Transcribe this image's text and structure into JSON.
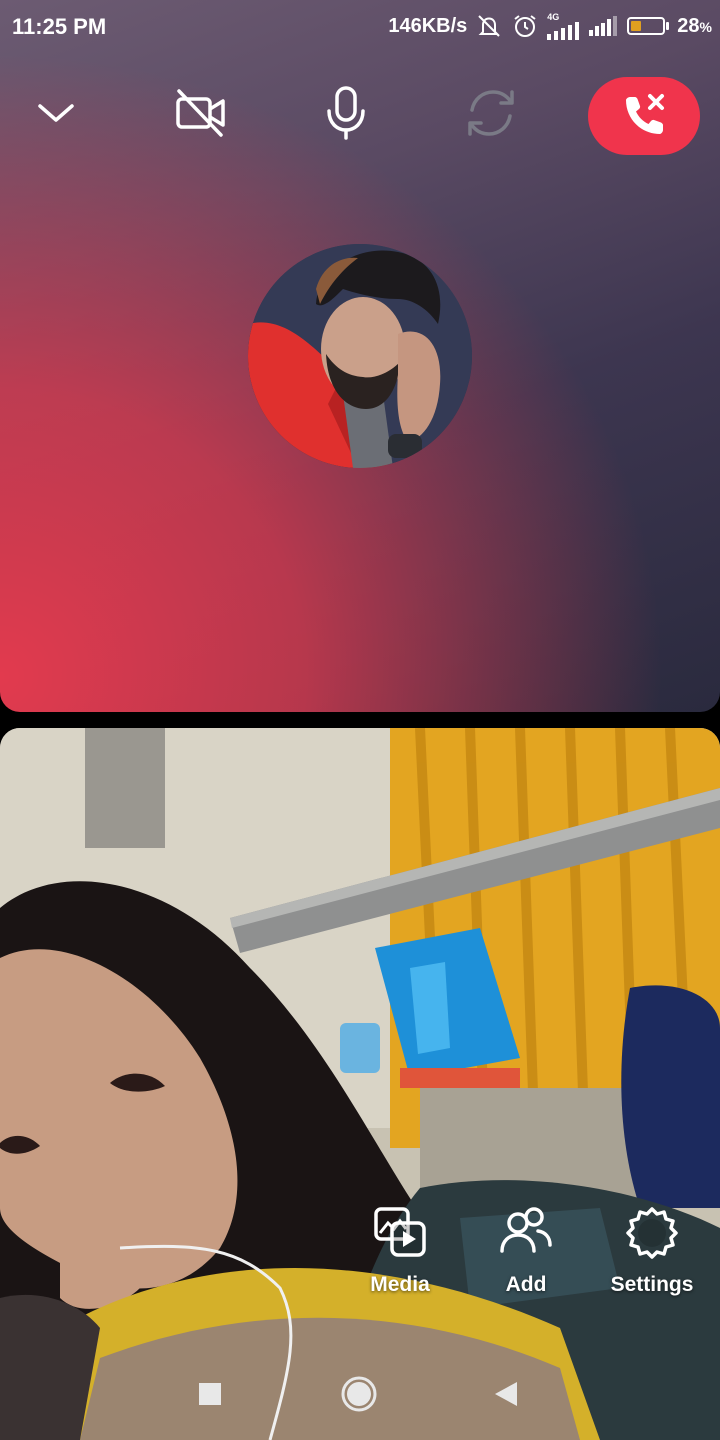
{
  "status_bar": {
    "time": "11:25 PM",
    "network_speed": "146KB/s",
    "network_type": "4G",
    "battery_percent": "28",
    "battery_symbol": "%",
    "icons": [
      "mute-icon",
      "alarm-icon",
      "signal-4g-icon",
      "signal-icon",
      "battery-icon"
    ]
  },
  "call_toolbar": {
    "buttons": [
      {
        "name": "minimize",
        "icon": "chevron-down-icon"
      },
      {
        "name": "video-off",
        "icon": "video-off-icon"
      },
      {
        "name": "microphone",
        "icon": "microphone-icon"
      },
      {
        "name": "switch-camera",
        "icon": "camera-switch-icon",
        "disabled": true
      },
      {
        "name": "end-call",
        "icon": "end-call-icon",
        "color": "#f0344c"
      }
    ]
  },
  "remote": {
    "avatar": "caller-avatar"
  },
  "quick_actions": {
    "items": [
      {
        "label": "Media",
        "icon": "media-icon"
      },
      {
        "label": "Add",
        "icon": "add-people-icon"
      },
      {
        "label": "Settings",
        "icon": "gear-icon"
      }
    ]
  },
  "nav_bar": {
    "icons": [
      "recents-square-icon",
      "home-circle-icon",
      "back-triangle-icon"
    ]
  },
  "colors": {
    "end_call": "#f0344c",
    "remote_gradient_warm": "#e23a4e",
    "remote_gradient_cool": "#2a2a3e"
  }
}
